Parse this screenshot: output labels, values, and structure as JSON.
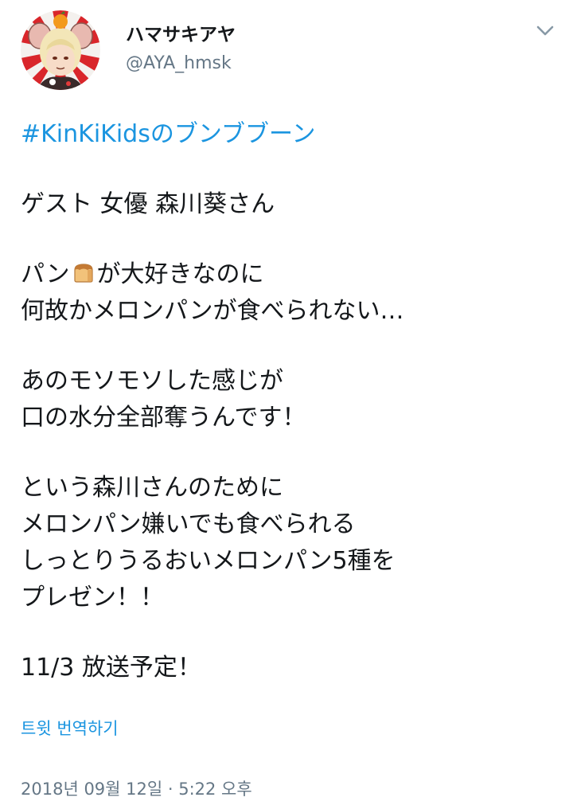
{
  "header": {
    "display_name": "ハマサキアヤ",
    "handle": "@AYA_hmsk",
    "avatar_icon": "profile-avatar",
    "caret_icon": "chevron-down-icon"
  },
  "tweet": {
    "hashtag": "#KinKiKidsのブンブブーン",
    "line_guest": "ゲスト 女優 森川葵さん",
    "line_pan_a": "パン",
    "bread_icon": "bread-emoji",
    "line_pan_b": "が大好きなのに",
    "line_melon": "何故かメロンパンが食べられない…",
    "line_moso": "あのモソモソした感じが",
    "line_mouth": "口の水分全部奪うんです！",
    "line_for": "という森川さんのために",
    "line_even": "メロンパン嫌いでも食べられる",
    "line_moist": "しっとりうるおいメロンパン5種を",
    "line_present": "プレゼン！！",
    "line_air": "11/3 放送予定！"
  },
  "translate_label": "트윗 번역하기",
  "timestamp": "2018년 09월 12일 · 5:22 오후",
  "colors": {
    "link": "#1b95e0",
    "muted": "#657786",
    "text": "#14171a"
  }
}
